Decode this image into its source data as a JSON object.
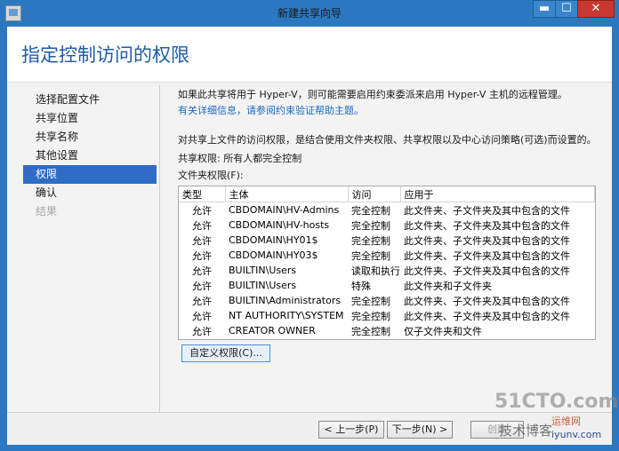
{
  "window": {
    "title": "新建共享向导",
    "controls": {
      "minimize": "▬",
      "maximize": "☐",
      "close": "✕"
    }
  },
  "page_title": "指定控制访问的权限",
  "nav": {
    "items": [
      {
        "label": "选择配置文件",
        "state": "normal"
      },
      {
        "label": "共享位置",
        "state": "normal"
      },
      {
        "label": "共享名称",
        "state": "normal"
      },
      {
        "label": "其他设置",
        "state": "normal"
      },
      {
        "label": "权限",
        "state": "active"
      },
      {
        "label": "确认",
        "state": "normal"
      },
      {
        "label": "结果",
        "state": "disabled"
      }
    ]
  },
  "content": {
    "intro": "如果此共享将用于 Hyper-V，则可能需要启用约束委派来启用 Hyper-V 主机的远程管理。",
    "link": "有关详细信息，请参阅约束验证帮助主题。",
    "description": "对共享上文件的访问权限，是结合使用文件夹权限、共享权限以及中心访问策略(可选)而设置的。",
    "share_perm": "共享权限: 所有人都完全控制",
    "folder_perm_label": "文件夹权限(F):"
  },
  "permissions_table": {
    "columns": [
      "类型",
      "主体",
      "访问",
      "应用于"
    ],
    "rows": [
      {
        "type": "允许",
        "principal": "CBDOMAIN\\HV-Admins",
        "access": "完全控制",
        "applies": "此文件夹、子文件夹及其中包含的文件"
      },
      {
        "type": "允许",
        "principal": "CBDOMAIN\\HV-hosts",
        "access": "完全控制",
        "applies": "此文件夹、子文件夹及其中包含的文件"
      },
      {
        "type": "允许",
        "principal": "CBDOMAIN\\HY01$",
        "access": "完全控制",
        "applies": "此文件夹、子文件夹及其中包含的文件"
      },
      {
        "type": "允许",
        "principal": "CBDOMAIN\\HY03$",
        "access": "完全控制",
        "applies": "此文件夹、子文件夹及其中包含的文件"
      },
      {
        "type": "允许",
        "principal": "BUILTIN\\Users",
        "access": "读取和执行",
        "applies": "此文件夹、子文件夹及其中包含的文件"
      },
      {
        "type": "允许",
        "principal": "BUILTIN\\Users",
        "access": "特殊",
        "applies": "此文件夹和子文件夹"
      },
      {
        "type": "允许",
        "principal": "BUILTIN\\Administrators",
        "access": "完全控制",
        "applies": "此文件夹、子文件夹及其中包含的文件"
      },
      {
        "type": "允许",
        "principal": "NT AUTHORITY\\SYSTEM",
        "access": "完全控制",
        "applies": "此文件夹、子文件夹及其中包含的文件"
      },
      {
        "type": "允许",
        "principal": "CREATOR OWNER",
        "access": "完全控制",
        "applies": "仅子文件夹和文件"
      }
    ]
  },
  "buttons": {
    "custom": "自定义权限(C)...",
    "prev": "< 上一步(P)",
    "next": "下一步(N) >",
    "create": "创建"
  },
  "watermark": {
    "line1": "51CTO.com",
    "line2": "技术博客",
    "line3": "运维网",
    "line4": "iyunv.com"
  },
  "colors": {
    "frame": "#2b78c0",
    "accent": "#1e5aa8",
    "active_nav": "#2e6cc5",
    "close": "#c7392f"
  }
}
